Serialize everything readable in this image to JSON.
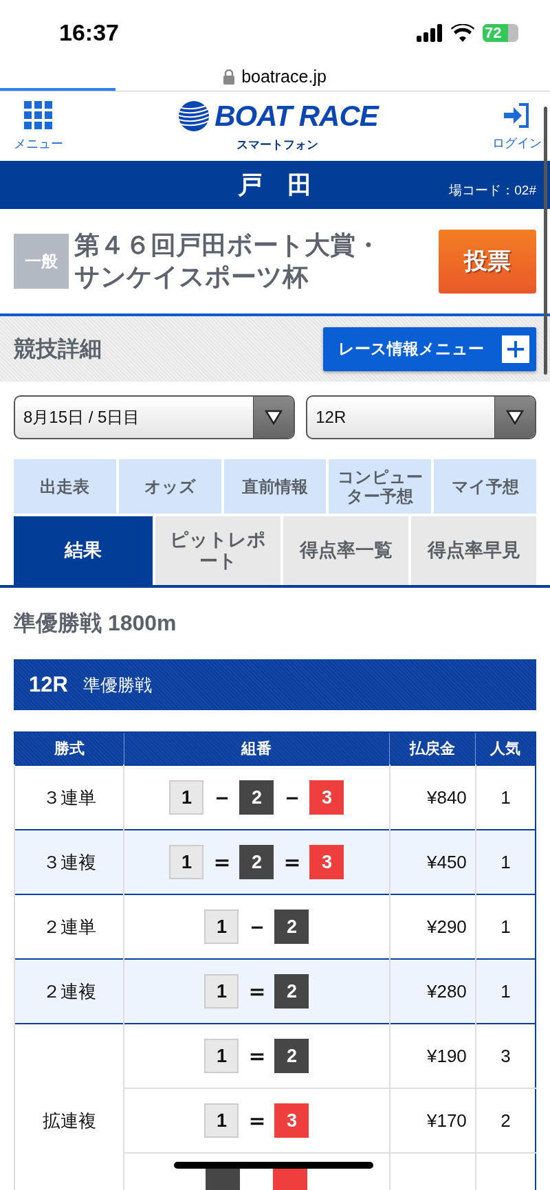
{
  "status_bar": {
    "time": "16:37",
    "battery": "72"
  },
  "browser": {
    "url": "boatrace.jp",
    "level": 0.21
  },
  "header": {
    "menu_label": "メニュー",
    "logo": "BOAT RACE",
    "logo_sub": "スマートフォン",
    "login_label": "ログイン"
  },
  "venue": {
    "name": "戸　田",
    "code": "場コード：02#"
  },
  "race_title": {
    "grade": "一般",
    "title": "第４６回戸田ボート大賞・サンケイスポーツ杯",
    "vote": "投票"
  },
  "section": {
    "title": "競技詳細",
    "menu_button": "レース情報メニュー"
  },
  "selects": [
    {
      "value": "8月15日 / 5日目"
    },
    {
      "value": "12R"
    }
  ],
  "tab_rows": [
    {
      "kind": "forecast",
      "tabs": [
        {
          "label": "出走表",
          "selected": false
        },
        {
          "label": "オッズ",
          "selected": false
        },
        {
          "label": "直前情報",
          "selected": false
        },
        {
          "label": "コンピューター予想",
          "selected": false
        },
        {
          "label": "マイ予想",
          "selected": false
        }
      ]
    },
    {
      "kind": "info",
      "tabs": [
        {
          "label": "結果",
          "selected": true
        },
        {
          "label": "ピットレポート",
          "selected": false
        },
        {
          "label": "得点率一覧",
          "selected": false
        },
        {
          "label": "得点率早見",
          "selected": false
        }
      ]
    }
  ],
  "race": {
    "heading": "準優勝戦 1800m",
    "number": "12R",
    "name": "準優勝戦"
  },
  "payouts": {
    "columns": [
      "勝式",
      "組番",
      "払戻金",
      "人気"
    ],
    "groups": [
      {
        "bet": "３連単",
        "rows": [
          {
            "combo": [
              {
                "kind": "boat",
                "text": "1",
                "color": "#e8e8e8"
              },
              {
                "kind": "sep",
                "text": "－"
              },
              {
                "kind": "boat",
                "text": "2",
                "color": "#464646"
              },
              {
                "kind": "sep",
                "text": "－"
              },
              {
                "kind": "boat",
                "text": "3",
                "color": "#ee3e3e"
              }
            ],
            "payout": "¥840",
            "popularity": "1"
          }
        ]
      },
      {
        "bet": "３連複",
        "rows": [
          {
            "combo": [
              {
                "kind": "boat",
                "text": "1",
                "color": "#e8e8e8"
              },
              {
                "kind": "sep",
                "text": "＝"
              },
              {
                "kind": "boat",
                "text": "2",
                "color": "#464646"
              },
              {
                "kind": "sep",
                "text": "＝"
              },
              {
                "kind": "boat",
                "text": "3",
                "color": "#ee3e3e"
              }
            ],
            "payout": "¥450",
            "popularity": "1"
          }
        ]
      },
      {
        "bet": "２連単",
        "rows": [
          {
            "combo": [
              {
                "kind": "boat",
                "text": "1",
                "color": "#e8e8e8"
              },
              {
                "kind": "sep",
                "text": "－"
              },
              {
                "kind": "boat",
                "text": "2",
                "color": "#464646"
              }
            ],
            "payout": "¥290",
            "popularity": "1"
          }
        ]
      },
      {
        "bet": "２連複",
        "rows": [
          {
            "combo": [
              {
                "kind": "boat",
                "text": "1",
                "color": "#e8e8e8"
              },
              {
                "kind": "sep",
                "text": "＝"
              },
              {
                "kind": "boat",
                "text": "2",
                "color": "#464646"
              }
            ],
            "payout": "¥280",
            "popularity": "1"
          }
        ]
      },
      {
        "bet": "拡連複",
        "rows": [
          {
            "combo": [
              {
                "kind": "boat",
                "text": "1",
                "color": "#e8e8e8"
              },
              {
                "kind": "sep",
                "text": "＝"
              },
              {
                "kind": "boat",
                "text": "2",
                "color": "#464646"
              }
            ],
            "payout": "¥190",
            "popularity": "3"
          },
          {
            "combo": [
              {
                "kind": "boat",
                "text": "1",
                "color": "#e8e8e8"
              },
              {
                "kind": "sep",
                "text": "＝"
              },
              {
                "kind": "boat",
                "text": "3",
                "color": "#ee3e3e"
              }
            ],
            "payout": "¥170",
            "popularity": "2"
          },
          {
            "combo": [
              {
                "kind": "boat",
                "color": "#464646"
              },
              {
                "kind": "gap"
              },
              {
                "kind": "boat",
                "color": "#ee3e3e"
              }
            ]
          }
        ]
      }
    ]
  }
}
